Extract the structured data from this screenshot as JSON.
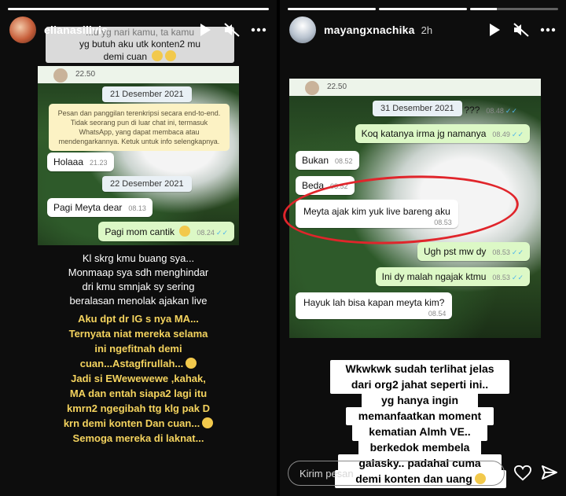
{
  "left_story": {
    "username": "elianasilivis",
    "top_caption": [
      "...u yg nari kamu, ta kamu",
      "yg butuh aku utk konten2 mu",
      "demi cuan"
    ],
    "chat": {
      "topbar_time": "22.50",
      "date1": "21 Desember 2021",
      "encryption_note": "Pesan dan panggilan terenkripsi secara end-to-end. Tidak seorang pun di luar chat ini, termasuk WhatsApp, yang dapat membaca atau mendengarkannya. Ketuk untuk info selengkapnya.",
      "msg1": {
        "text": "Holaaa",
        "time": "21.23"
      },
      "date2": "22 Desember 2021",
      "msg2": {
        "text": "Pagi Meyta dear",
        "time": "08.13"
      },
      "msg3": {
        "text": "Pagi mom cantik",
        "time": "08.24",
        "tick": "✓✓"
      }
    },
    "caption_white": [
      "Kl skrg kmu buang sya...",
      "Monmaap sya sdh menghindar",
      "dri kmu smnjak sy sering",
      "beralasan menolak ajakan live"
    ],
    "caption_yellow": [
      "Aku dpt dr IG s nya MA...",
      "Ternyata niat mereka selama",
      "ini ngefitnah demi",
      "cuan...Astagfirullah...",
      "Jadi si EWewewewe ,kahak,",
      "MA dan entah siapa2 lagi itu",
      "kmrn2 ngegibah ttg klg pak D",
      "krn demi konten Dan cuan...",
      "Semoga mereka di laknat..."
    ]
  },
  "right_story": {
    "username": "mayangxnachika",
    "time": "2h",
    "chat": {
      "topbar_time": "22.50",
      "date": "31 Desember 2021",
      "messages": [
        {
          "text": "???",
          "time": "08.48",
          "tick": "✓✓",
          "dir": "out"
        },
        {
          "text": "Koq katanya irma jg namanya",
          "time": "08.49",
          "tick": "✓✓",
          "dir": "out"
        },
        {
          "text": "Bukan",
          "time": "08.52",
          "dir": "in"
        },
        {
          "text": "Beda",
          "time": "08.52",
          "dir": "in"
        },
        {
          "text": "Meyta ajak kim yuk live bareng aku",
          "time": "08.53",
          "dir": "in"
        },
        {
          "text": "Ugh pst mw dy",
          "time": "08.53",
          "tick": "✓✓",
          "dir": "out"
        },
        {
          "text": "Ini dy malah ngajak ktmu",
          "time": "08.53",
          "tick": "✓✓",
          "dir": "out"
        },
        {
          "text": "Hayuk lah bisa kapan meyta kim?",
          "time": "08.54",
          "dir": "in"
        }
      ]
    },
    "caption": [
      "Wkwkwk sudah terlihat jelas",
      "dari org2 jahat seperti ini..",
      "yg hanya ingin",
      "memanfaatkan moment",
      "kematian Almh VE..",
      "berkedok membela",
      "galasky.. padahal cuma",
      "demi konten dan uang"
    ],
    "reply_placeholder": "Kirim pesan"
  },
  "icons": {
    "play": "play-icon",
    "mute": "mute-icon",
    "more": "more-icon",
    "heart": "heart-icon",
    "send": "send-icon"
  },
  "colors": {
    "accent_yellow": "#f4d35e",
    "ring_red": "#e0252b",
    "wa_out": "#dcf8c6"
  }
}
